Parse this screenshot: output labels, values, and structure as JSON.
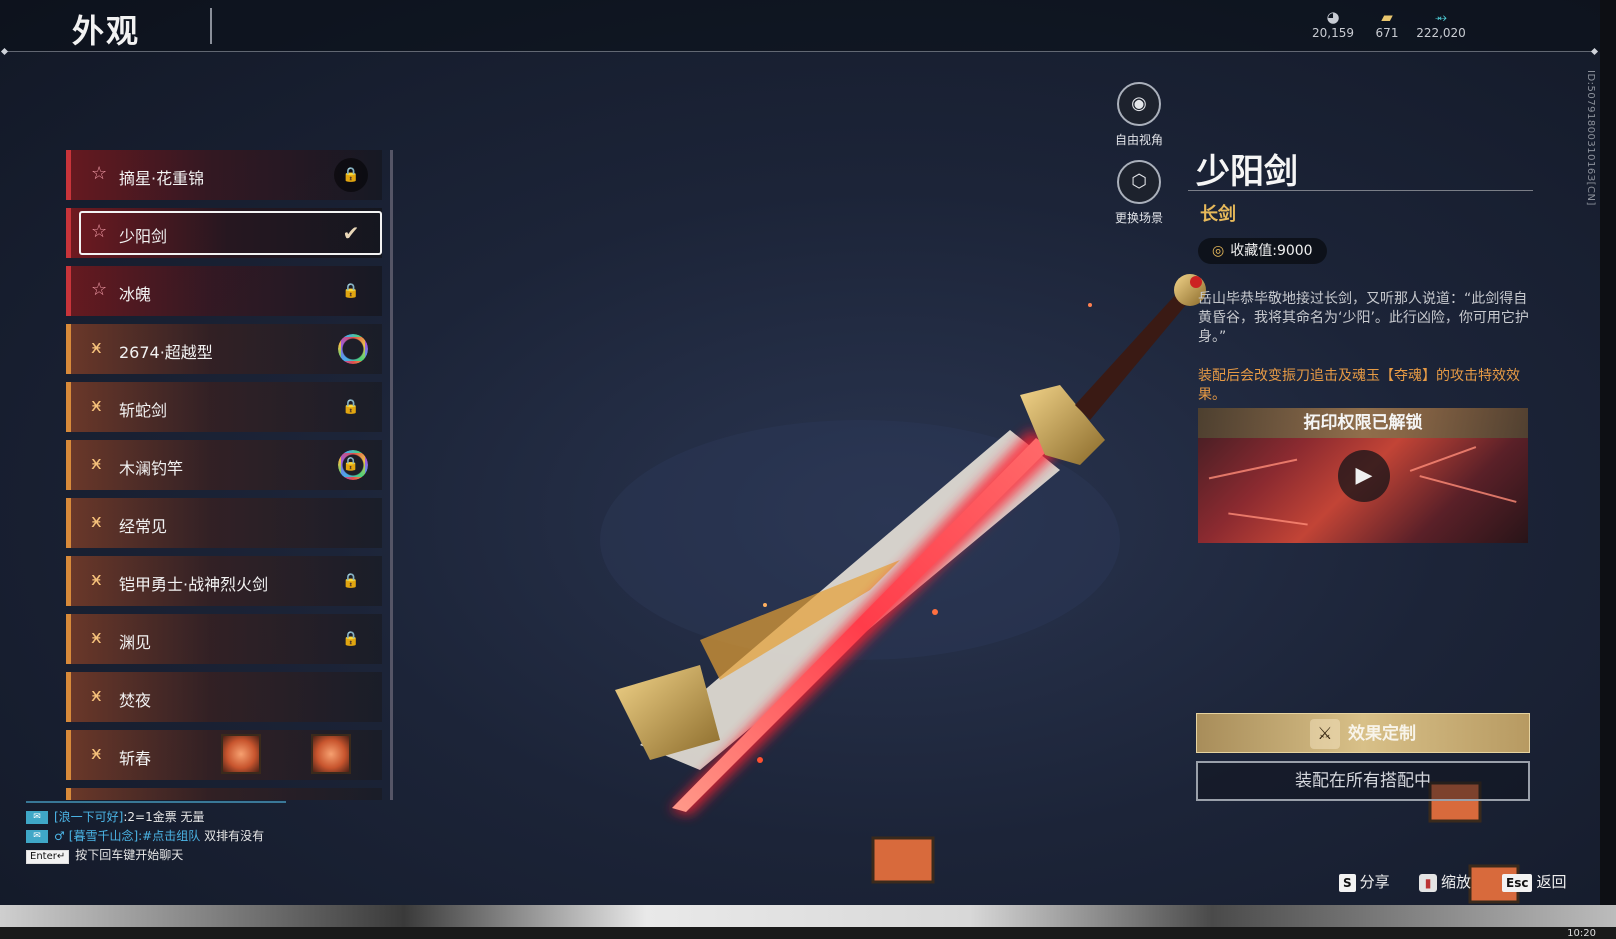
{
  "header": {
    "title": "外观",
    "currencies": [
      {
        "icon": "silver-coin-icon",
        "value": "20,159"
      },
      {
        "icon": "gold-ticket-icon",
        "value": "671"
      },
      {
        "icon": "jade-feather-icon",
        "value": "222,020"
      }
    ]
  },
  "side_id": "ID:5079180031016З[CN]",
  "camera": {
    "free_view_label": "自由视角",
    "change_scene_label": "更换场景"
  },
  "list": {
    "items": [
      {
        "label": "摘星·花重锦",
        "tier": "red",
        "state": "lock-badge",
        "glyph": "☆"
      },
      {
        "label": "少阳剑",
        "tier": "red",
        "state": "check",
        "glyph": "☆",
        "selected": true
      },
      {
        "label": "冰魄",
        "tier": "red",
        "state": "lock",
        "glyph": "☆"
      },
      {
        "label": "2674·超越型",
        "tier": "orange",
        "state": "ring",
        "glyph": "ӿ"
      },
      {
        "label": "斩蛇剑",
        "tier": "orange",
        "state": "lock",
        "glyph": "ӿ"
      },
      {
        "label": "木澜钓竿",
        "tier": "orange",
        "state": "ring-lock",
        "glyph": "ӿ"
      },
      {
        "label": "经常见",
        "tier": "orange",
        "state": "none",
        "glyph": "ӿ"
      },
      {
        "label": "铠甲勇士·战神烈火剑",
        "tier": "orange",
        "state": "lock",
        "glyph": "ӿ"
      },
      {
        "label": "渊见",
        "tier": "orange",
        "state": "lock",
        "glyph": "ӿ"
      },
      {
        "label": "焚夜",
        "tier": "orange",
        "state": "none",
        "glyph": "ӿ"
      },
      {
        "label": "斩春",
        "tier": "orange",
        "state": "none",
        "glyph": "ӿ"
      }
    ]
  },
  "detail": {
    "name": "少阳剑",
    "type": "长剑",
    "collection_label": "收藏值:",
    "collection_value": "9000",
    "description": "岳山毕恭毕敬地接过长剑，又听那人说道：“此剑得自黄昏谷，我将其命名为‘少阳’。此行凶险，你可用它护身。”",
    "effect_note": "装配后会改变振刀追击及魂玉【夺魂】的攻击特效效果。",
    "video_title": "拓印权限已解锁",
    "custom_button": "效果定制",
    "equip_button": "装配在所有搭配中"
  },
  "chat": {
    "lines": [
      {
        "name": "[浪一下可好]",
        "text": ":2=1金票 无量"
      },
      {
        "name": "[暮雪千山念]",
        "tag": ":#点击组队",
        "text": " 双排有没有"
      }
    ],
    "enter_key": "Enter↵",
    "prompt": "按下回车键开始聊天"
  },
  "hints": {
    "share_key": "S",
    "share_label": "分享",
    "zoom_label": "缩放",
    "back_key": "Esc",
    "back_label": "返回"
  },
  "clock": "10:20",
  "colors": {
    "red_tier": "#c8343a",
    "orange_tier": "#d88a3a",
    "gold_text": "#e7b95a",
    "effect_text": "#e69a45"
  }
}
